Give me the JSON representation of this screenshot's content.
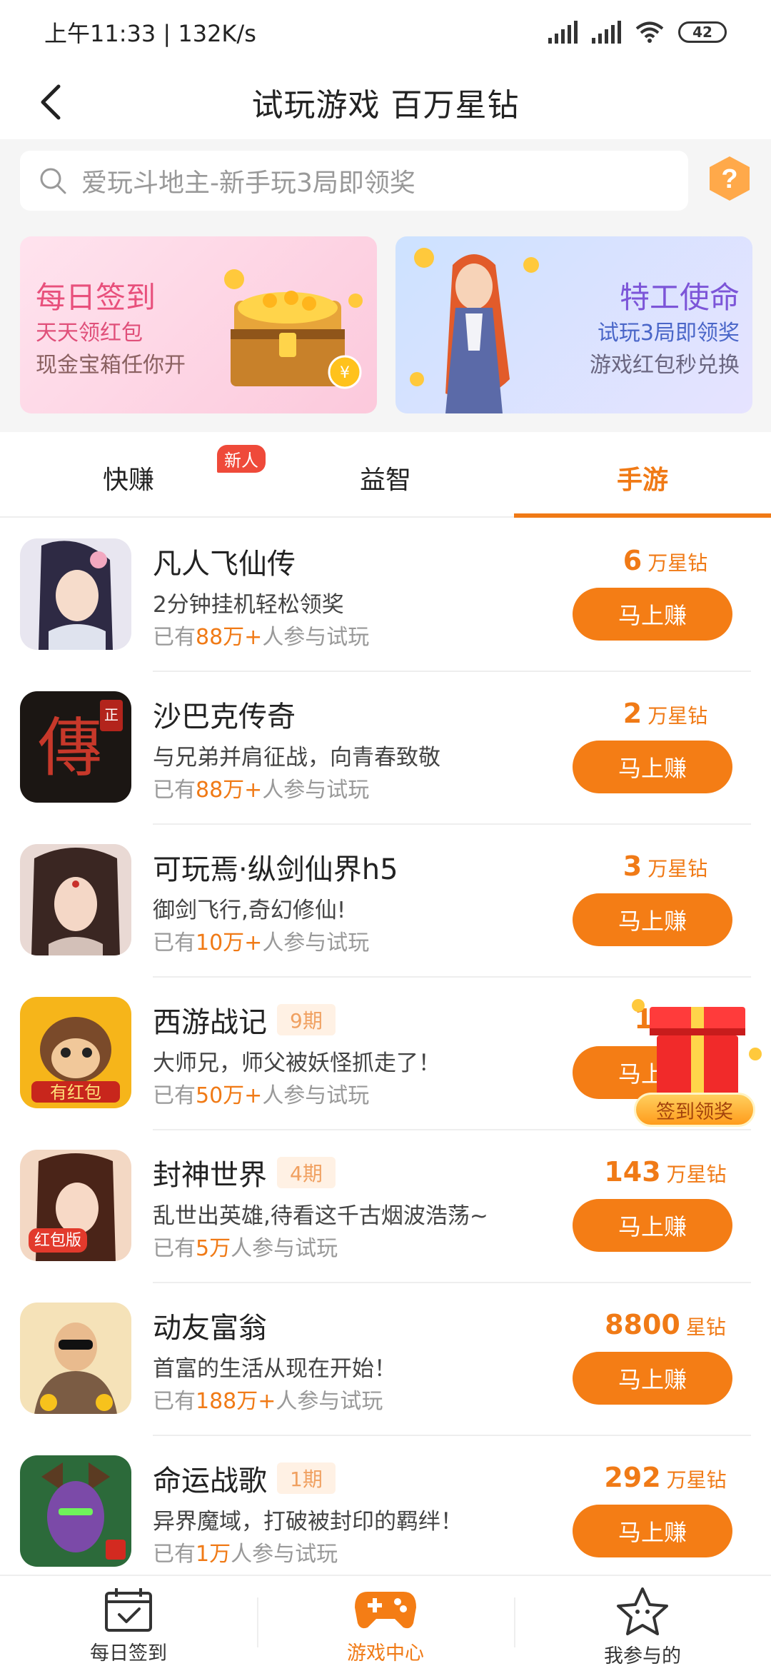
{
  "status_bar": {
    "time": "上午11:33 | 132K/s",
    "battery": "42"
  },
  "header": {
    "title": "试玩游戏 百万星钻"
  },
  "search": {
    "placeholder": "爱玩斗地主-新手玩3局即领奖"
  },
  "banners": [
    {
      "title": "每日签到",
      "subtitle": "天天领红包",
      "desc": "现金宝箱任你开"
    },
    {
      "title": "特工使命",
      "subtitle": "试玩3局即领奖",
      "desc": "游戏红包秒兑换"
    }
  ],
  "tabs": [
    {
      "label": "快赚",
      "badge": "新人"
    },
    {
      "label": "益智"
    },
    {
      "label": "手游",
      "active": true
    }
  ],
  "games": [
    {
      "name": "凡人飞仙传",
      "period": "",
      "desc": "2分钟挂机轻松领奖",
      "players_prefix": "已有",
      "players_count": "88万+",
      "players_suffix": "人参与试玩",
      "reward_value": "6",
      "reward_unit": "万星钻",
      "button": "马上赚"
    },
    {
      "name": "沙巴克传奇",
      "period": "",
      "desc": "与兄弟并肩征战，向青春致敬",
      "players_prefix": "已有",
      "players_count": "88万+",
      "players_suffix": "人参与试玩",
      "reward_value": "2",
      "reward_unit": "万星钻",
      "button": "马上赚"
    },
    {
      "name": "可玩焉·纵剑仙界h5",
      "period": "",
      "desc": "御剑飞行,奇幻修仙!",
      "players_prefix": "已有",
      "players_count": "10万+",
      "players_suffix": "人参与试玩",
      "reward_value": "3",
      "reward_unit": "万星钻",
      "button": "马上赚"
    },
    {
      "name": "西游战记",
      "period": "9期",
      "desc": "大师兄，师父被妖怪抓走了！",
      "players_prefix": "已有",
      "players_count": "50万+",
      "players_suffix": "人参与试玩",
      "reward_value": "176",
      "reward_unit": "",
      "button": "马上赚"
    },
    {
      "name": "封神世界",
      "period": "4期",
      "desc": "乱世出英雄,待看这千古烟波浩荡~",
      "players_prefix": "已有",
      "players_count": "5万",
      "players_suffix": "人参与试玩",
      "reward_value": "143",
      "reward_unit": "万星钻",
      "button": "马上赚"
    },
    {
      "name": "动友富翁",
      "period": "",
      "desc": "首富的生活从现在开始！",
      "players_prefix": "已有",
      "players_count": "188万+",
      "players_suffix": "人参与试玩",
      "reward_value": "8800",
      "reward_unit": "星钻",
      "button": "马上赚"
    },
    {
      "name": "命运战歌",
      "period": "1期",
      "desc": "异界魔域，打破被封印的羁绊！",
      "players_prefix": "已有",
      "players_count": "1万",
      "players_suffix": "人参与试玩",
      "reward_value": "292",
      "reward_unit": "万星钻",
      "button": "马上赚"
    }
  ],
  "floating_gift": {
    "label": "签到领奖"
  },
  "bottom_nav": [
    {
      "label": "每日签到",
      "icon": "calendar-check-icon"
    },
    {
      "label": "游戏中心",
      "icon": "gamepad-icon",
      "active": true
    },
    {
      "label": "我参与的",
      "icon": "star-icon"
    }
  ],
  "colors": {
    "accent": "#f47d15",
    "badge_red": "#ef4a3a"
  }
}
